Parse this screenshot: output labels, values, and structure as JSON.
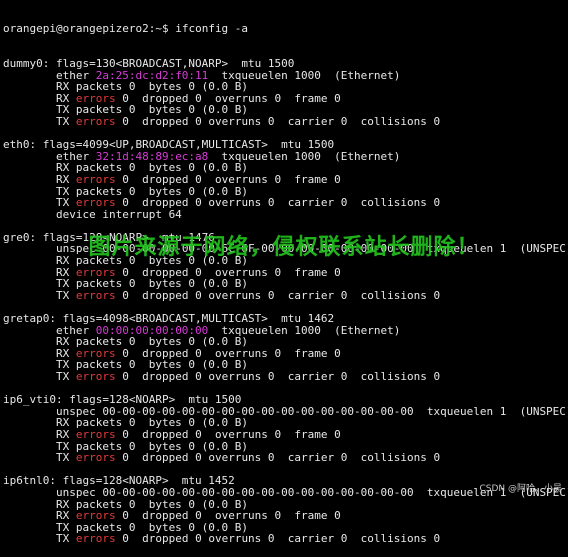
{
  "colors": {
    "background": "#000000",
    "text": "#e8e8e8",
    "mac_address": "#d83ad8",
    "errors": "#e03b3b",
    "watermark": "#22c21e"
  },
  "prompt": "orangepi@orangepizero2:~$",
  "command": "ifconfig -a",
  "interfaces": [
    {
      "header": "dummy0: flags=130<BROADCAST,NOARP>  mtu 1500",
      "addr_prefix": "        ether ",
      "addr": "2a:25:dc:d2:f0:11",
      "addr_suffix": "  txqueuelen 1000  (Ethernet)",
      "addr_colored": true,
      "rx_packets": "        RX packets 0  bytes 0 (0.0 B)",
      "rx_errors_rest": " 0  dropped 0  overruns 0  frame 0",
      "tx_packets": "        TX packets 0  bytes 0 (0.0 B)",
      "tx_errors_rest": " 0  dropped 0 overruns 0  carrier 0  collisions 0",
      "extra": ""
    },
    {
      "header": "eth0: flags=4099<UP,BROADCAST,MULTICAST>  mtu 1500",
      "addr_prefix": "        ether ",
      "addr": "32:1d:48:89:ec:a8",
      "addr_suffix": "  txqueuelen 1000  (Ethernet)",
      "addr_colored": true,
      "rx_packets": "        RX packets 0  bytes 0 (0.0 B)",
      "rx_errors_rest": " 0  dropped 0  overruns 0  frame 0",
      "tx_packets": "        TX packets 0  bytes 0 (0.0 B)",
      "tx_errors_rest": " 0  dropped 0 overruns 0  carrier 0  collisions 0",
      "extra": "        device interrupt 64"
    },
    {
      "header": "gre0: flags=128<NOARP>  mtu 1476",
      "addr_prefix": "        unspec ",
      "addr": "00-00-00-00-00-00-6C-6F-00-00-00-00-00-00-00-00",
      "addr_suffix": "  txqueuelen 1  (UNSPEC)",
      "addr_colored": false,
      "rx_packets": "        RX packets 0  bytes 0 (0.0 B)",
      "rx_errors_rest": " 0  dropped 0  overruns 0  frame 0",
      "tx_packets": "        TX packets 0  bytes 0 (0.0 B)",
      "tx_errors_rest": " 0  dropped 0 overruns 0  carrier 0  collisions 0",
      "extra": ""
    },
    {
      "header": "gretap0: flags=4098<BROADCAST,MULTICAST>  mtu 1462",
      "addr_prefix": "        ether ",
      "addr": "00:00:00:00:00:00",
      "addr_suffix": "  txqueuelen 1000  (Ethernet)",
      "addr_colored": true,
      "rx_packets": "        RX packets 0  bytes 0 (0.0 B)",
      "rx_errors_rest": " 0  dropped 0  overruns 0  frame 0",
      "tx_packets": "        TX packets 0  bytes 0 (0.0 B)",
      "tx_errors_rest": " 0  dropped 0 overruns 0  carrier 0  collisions 0",
      "extra": ""
    },
    {
      "header": "ip6_vti0: flags=128<NOARP>  mtu 1500",
      "addr_prefix": "        unspec ",
      "addr": "00-00-00-00-00-00-00-00-00-00-00-00-00-00-00-00",
      "addr_suffix": "  txqueuelen 1  (UNSPEC)",
      "addr_colored": false,
      "rx_packets": "        RX packets 0  bytes 0 (0.0 B)",
      "rx_errors_rest": " 0  dropped 0  overruns 0  frame 0",
      "tx_packets": "        TX packets 0  bytes 0 (0.0 B)",
      "tx_errors_rest": " 0  dropped 0 overruns 0  carrier 0  collisions 0",
      "extra": ""
    },
    {
      "header": "ip6tnl0: flags=128<NOARP>  mtu 1452",
      "addr_prefix": "        unspec ",
      "addr": "00-00-00-00-00-00-00-00-00-00-00-00-00-00-00-00",
      "addr_suffix": "  txqueuelen 1  (UNSPEC)",
      "addr_colored": false,
      "rx_packets": "        RX packets 0  bytes 0 (0.0 B)",
      "rx_errors_rest": " 0  dropped 0  overruns 0  frame 0",
      "tx_packets": "        TX packets 0  bytes 0 (0.0 B)",
      "tx_errors_rest": " 0  dropped 0 overruns 0  carrier 0  collisions 0",
      "extra": ""
    }
  ],
  "rx_label": "        RX ",
  "tx_label": "        TX ",
  "errors_word": "errors",
  "watermark": "图片来源于网络，侵权联系站长删除！",
  "credit": "CSDN @阿哈、小吴"
}
